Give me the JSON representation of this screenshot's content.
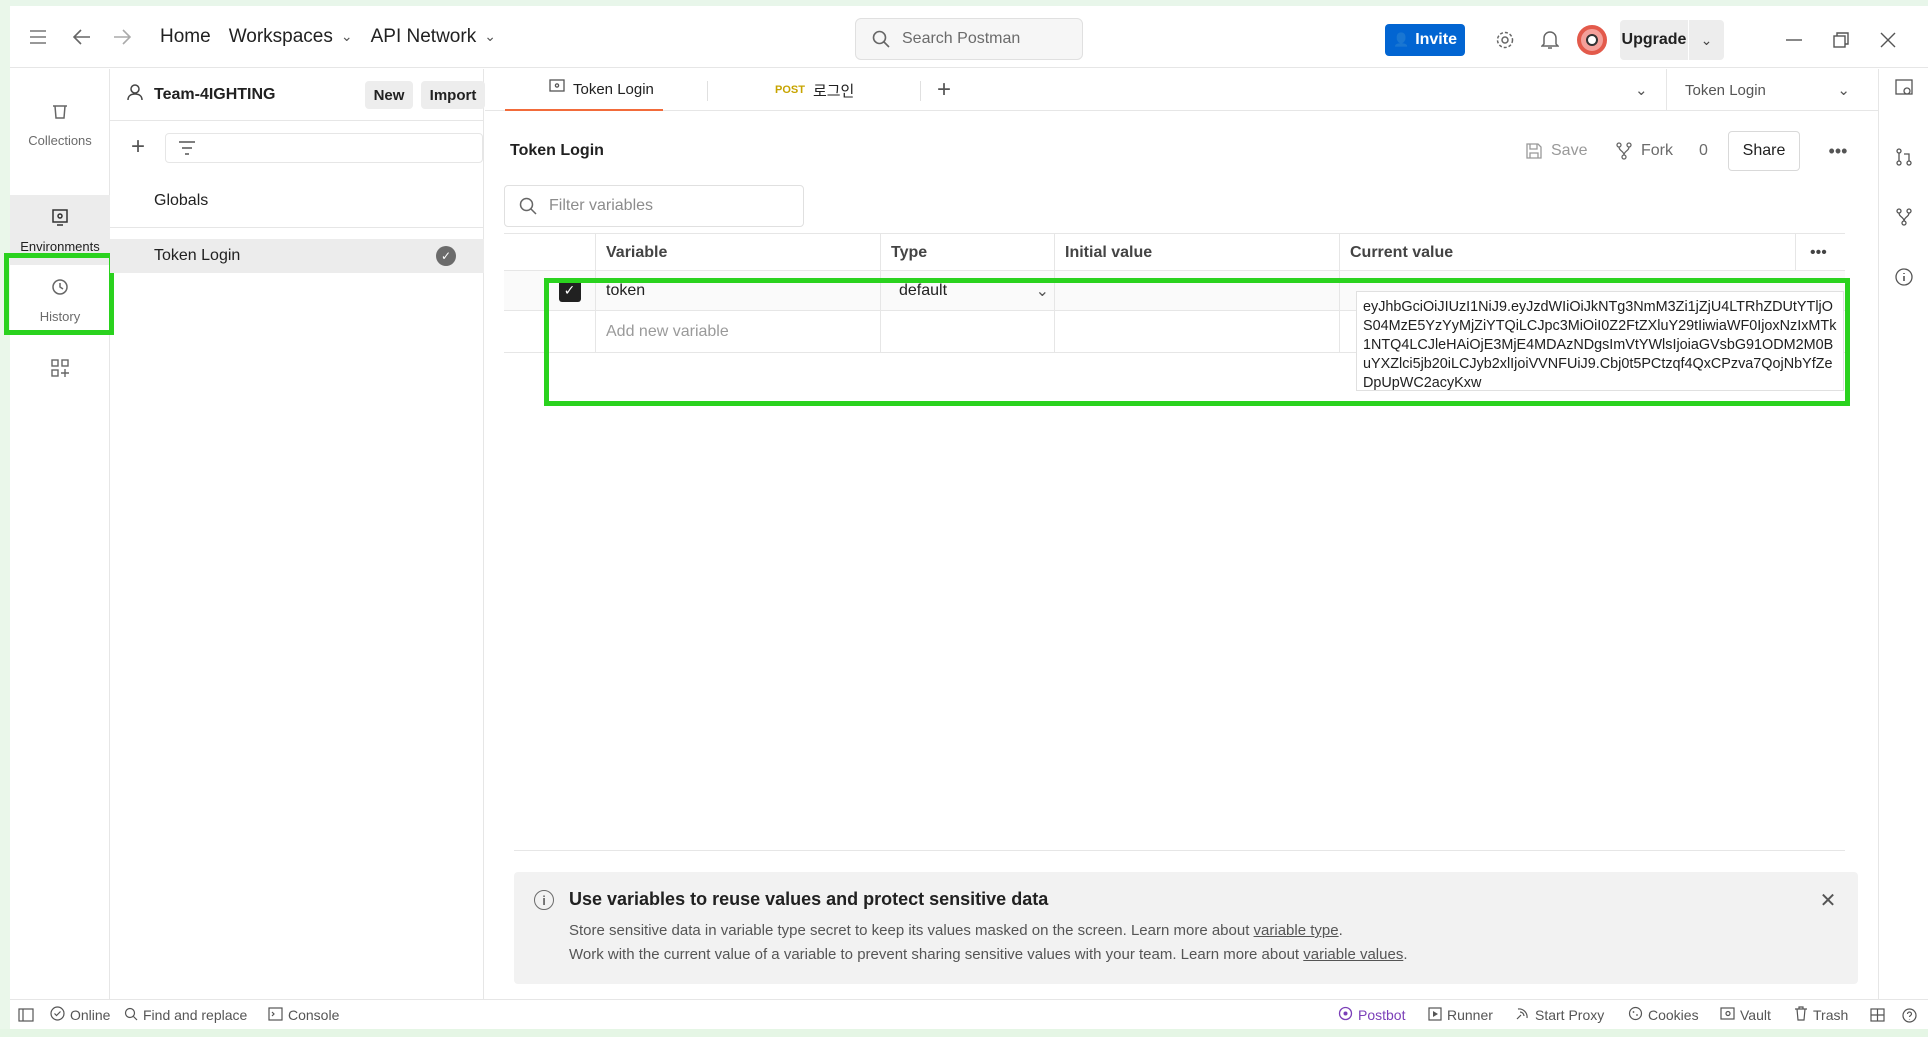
{
  "topbar": {
    "home": "Home",
    "workspaces": "Workspaces",
    "api_network": "API Network",
    "search_placeholder": "Search Postman",
    "invite": "Invite",
    "upgrade": "Upgrade"
  },
  "rail": {
    "collections": "Collections",
    "environments": "Environments",
    "history": "History"
  },
  "sidebar": {
    "workspace_name": "Team-4IGHTING",
    "new_label": "New",
    "import_label": "Import",
    "items": [
      {
        "label": "Globals"
      },
      {
        "label": "Token Login"
      }
    ]
  },
  "tabs": [
    {
      "label": "Token Login",
      "method": ""
    },
    {
      "label": "로그인",
      "method": "POST"
    }
  ],
  "env_selector": "Token Login",
  "editor": {
    "title": "Token Login",
    "save": "Save",
    "fork": "Fork",
    "fork_count": "0",
    "share": "Share",
    "filter_placeholder": "Filter variables"
  },
  "table": {
    "headers": [
      "Variable",
      "Type",
      "Initial value",
      "Current value"
    ],
    "rows": [
      {
        "variable": "token",
        "type": "default",
        "initial_value": "",
        "current_value": "eyJhbGciOiJIUzI1NiJ9.eyJzdWIiOiJkNTg3NmM3Zi1jZjU4LTRhZDUtYTljOS04MzE5YzYyMjZiYTQiLCJpc3MiOiI0Z2FtZXluY29tIiwiaWF0IjoxNzIxMTk1NTQ4LCJleHAiOjE3MjE4MDAzNDgsImVtYWlsIjoiaGVsbG91ODM2M0BuYXZlci5jb20iLCJyb2xlIjoiVVNFUiJ9.Cbj0t5PCtzqf4QxCPzva7QojNbYfZeDpUpWC2acyKxw"
      }
    ],
    "add_placeholder": "Add new variable"
  },
  "banner": {
    "title": "Use variables to reuse values and protect sensitive data",
    "line1_text": "Store sensitive data in variable type secret to keep its values masked on the screen. Learn more about ",
    "line1_link": "variable type",
    "line2_text": "Work with the current value of a variable to prevent sharing sensitive values with your team. Learn more about ",
    "line2_link": "variable values"
  },
  "statusbar": {
    "online": "Online",
    "find_replace": "Find and replace",
    "console": "Console",
    "postbot": "Postbot",
    "runner": "Runner",
    "start_proxy": "Start Proxy",
    "cookies": "Cookies",
    "vault": "Vault",
    "trash": "Trash"
  },
  "colors": {
    "highlight": "#2ad21e",
    "invite_blue": "#0265d2",
    "active_tab_underline": "#f26b3a"
  }
}
